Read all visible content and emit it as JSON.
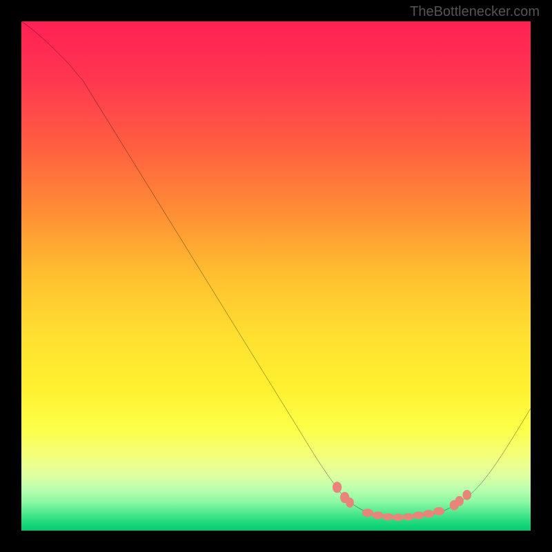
{
  "watermark": "TheBottlenecker.com",
  "chart_data": {
    "type": "line",
    "title": "",
    "xlabel": "",
    "ylabel": "",
    "xlim": [
      0,
      100
    ],
    "ylim": [
      0,
      100
    ],
    "curve": {
      "description": "Bottleneck curve - starts high top-left, descends to minimum near x=75, rises again",
      "points": [
        {
          "x": 0,
          "y": 100
        },
        {
          "x": 4,
          "y": 97.5
        },
        {
          "x": 8,
          "y": 94
        },
        {
          "x": 12,
          "y": 89
        },
        {
          "x": 55,
          "y": 19
        },
        {
          "x": 60,
          "y": 11
        },
        {
          "x": 63,
          "y": 7
        },
        {
          "x": 66,
          "y": 4.5
        },
        {
          "x": 70,
          "y": 3
        },
        {
          "x": 75,
          "y": 2.5
        },
        {
          "x": 80,
          "y": 3
        },
        {
          "x": 84,
          "y": 4.5
        },
        {
          "x": 88,
          "y": 7
        },
        {
          "x": 94,
          "y": 14
        },
        {
          "x": 100,
          "y": 24
        }
      ]
    },
    "highlight_dots": {
      "description": "Pink/coral dots marking the valley/optimal region",
      "color": "#e8857a",
      "points": [
        {
          "x": 62,
          "y": 8.5
        },
        {
          "x": 63.5,
          "y": 6.5
        },
        {
          "x": 64.5,
          "y": 5.5
        },
        {
          "x": 68,
          "y": 3.5
        },
        {
          "x": 70,
          "y": 3
        },
        {
          "x": 72,
          "y": 2.7
        },
        {
          "x": 74,
          "y": 2.6
        },
        {
          "x": 76,
          "y": 2.7
        },
        {
          "x": 78,
          "y": 3
        },
        {
          "x": 80,
          "y": 3.3
        },
        {
          "x": 82,
          "y": 3.8
        },
        {
          "x": 85,
          "y": 5
        },
        {
          "x": 86,
          "y": 5.8
        },
        {
          "x": 87.5,
          "y": 7
        }
      ]
    },
    "gradient_stops": [
      {
        "offset": 0,
        "color": "#ff2054"
      },
      {
        "offset": 25,
        "color": "#ff6040"
      },
      {
        "offset": 50,
        "color": "#ffc030"
      },
      {
        "offset": 70,
        "color": "#fff030"
      },
      {
        "offset": 82,
        "color": "#f8ff60"
      },
      {
        "offset": 88,
        "color": "#e0ffa0"
      },
      {
        "offset": 92,
        "color": "#b0ffb0"
      },
      {
        "offset": 95,
        "color": "#70f090"
      },
      {
        "offset": 97.5,
        "color": "#30e080"
      },
      {
        "offset": 100,
        "color": "#00cc70"
      }
    ]
  }
}
